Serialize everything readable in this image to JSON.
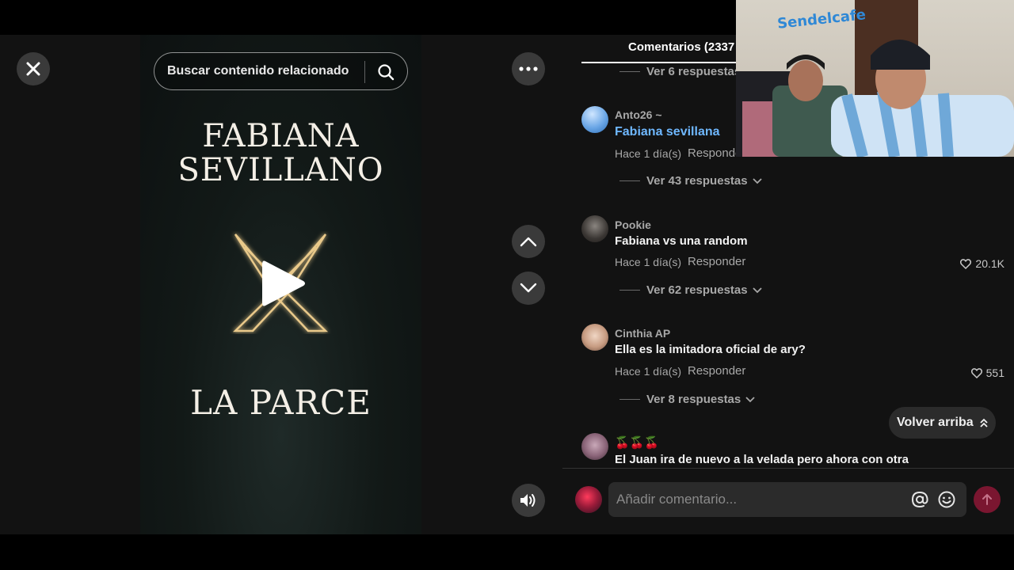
{
  "search": {
    "placeholder": "Buscar contenido relacionado"
  },
  "video": {
    "title_line1": "FABIANA",
    "title_line2": "SEVILLANO",
    "title_line3": "LA PARCE"
  },
  "comments": {
    "header": "Comentarios (2337",
    "top_replies": "Ver 6 respuestas",
    "items": [
      {
        "username": "Anto26 ~",
        "text": "Fabiana sevillana",
        "time": "Hace 1 día(s)",
        "reply": "Responder",
        "replies": "Ver 43 respuestas"
      },
      {
        "username": "Pookie",
        "text": "Fabiana vs una random",
        "time": "Hace 1 día(s)",
        "reply": "Responder",
        "likes": "20.1K",
        "replies": "Ver 62 respuestas"
      },
      {
        "username": "Cinthia AP",
        "text": "Ella es la imitadora oficial de ary?",
        "time": "Hace 1 día(s)",
        "reply": "Responder",
        "likes": "551",
        "replies": "Ver 8 respuestas"
      },
      {
        "username": "🍒🍒🍒",
        "text": "El Juan ira de nuevo a la velada pero ahora con otra"
      }
    ],
    "back_to_top": "Volver arriba",
    "input_placeholder": "Añadir comentario..."
  },
  "webcam": {
    "sign_text": "Sendelcafe"
  },
  "colors": {
    "accent_link": "#6fb8ff",
    "send_button": "#7a1630",
    "panel_bg": "#121212"
  }
}
